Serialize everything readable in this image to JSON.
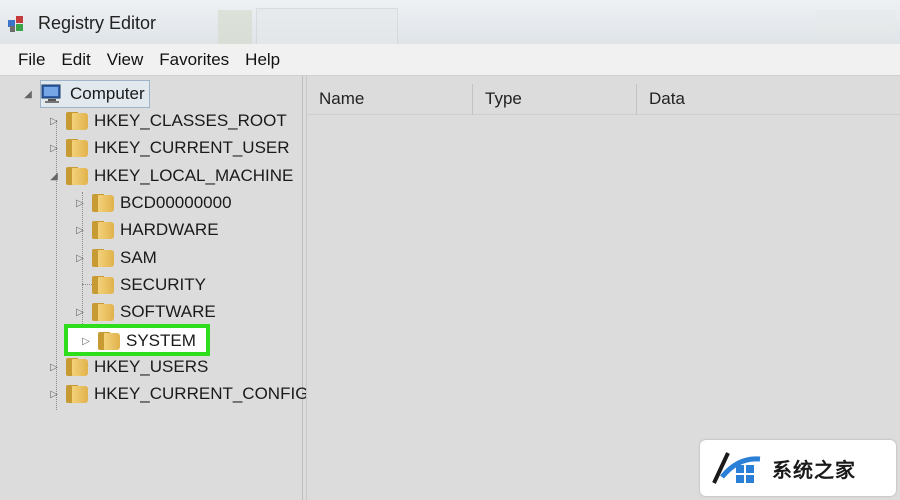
{
  "window": {
    "title": "Registry Editor"
  },
  "menu": [
    "File",
    "Edit",
    "View",
    "Favorites",
    "Help"
  ],
  "tree": {
    "root": "Computer",
    "hives": [
      {
        "label": "HKEY_CLASSES_ROOT",
        "expanded": false
      },
      {
        "label": "HKEY_CURRENT_USER",
        "expanded": false
      },
      {
        "label": "HKEY_LOCAL_MACHINE",
        "expanded": true,
        "children": [
          {
            "label": "BCD00000000"
          },
          {
            "label": "HARDWARE"
          },
          {
            "label": "SAM"
          },
          {
            "label": "SECURITY"
          },
          {
            "label": "SOFTWARE"
          },
          {
            "label": "SYSTEM",
            "highlighted": true
          }
        ]
      },
      {
        "label": "HKEY_USERS",
        "expanded": false
      },
      {
        "label": "HKEY_CURRENT_CONFIG",
        "expanded": false
      }
    ]
  },
  "columns": [
    "Name",
    "Type",
    "Data"
  ],
  "watermark": {
    "text": "系统之家"
  },
  "colors": {
    "highlight": "#2ede1c",
    "folder": "#e1b24c"
  }
}
